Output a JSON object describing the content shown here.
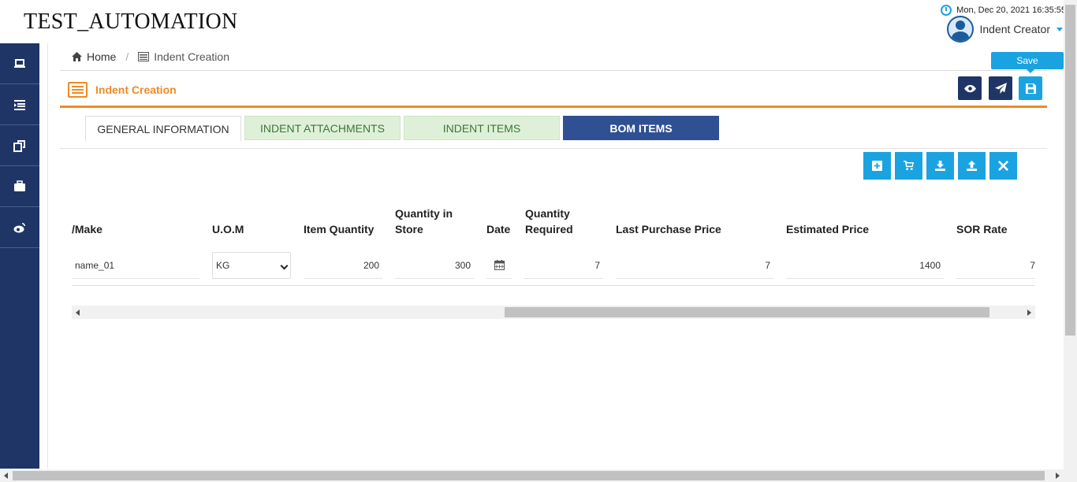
{
  "app": {
    "title": "TEST_AUTOMATION"
  },
  "header": {
    "datetime": "Mon, Dec 20, 2021 16:35:55",
    "user_name": "Indent Creator"
  },
  "sidebar": {
    "items": [
      {
        "icon": "laptop-icon"
      },
      {
        "icon": "indent-list-icon"
      },
      {
        "icon": "copy-icon"
      },
      {
        "icon": "briefcase-icon"
      },
      {
        "icon": "weibo-icon"
      }
    ]
  },
  "breadcrumb": {
    "home": "Home",
    "current": "Indent Creation"
  },
  "page": {
    "title": "Indent Creation"
  },
  "actions": {
    "tooltip": "Save"
  },
  "tabs": [
    {
      "label": "GENERAL INFORMATION"
    },
    {
      "label": "INDENT ATTACHMENTS"
    },
    {
      "label": "INDENT ITEMS"
    },
    {
      "label": "BOM ITEMS"
    }
  ],
  "table": {
    "headers": {
      "make": "/Make",
      "uom": "U.O.M",
      "item_qty": "Item Quantity",
      "qty_store_1": "Quantity in",
      "qty_store_2": "Store",
      "date": "Date",
      "qty_req_1": "Quantity",
      "qty_req_2": "Required",
      "last_price": "Last Purchase Price",
      "est_price": "Estimated Price",
      "sor": "SOR Rate"
    },
    "row": {
      "make": "name_01",
      "uom": "KG",
      "item_qty": "200",
      "qty_store": "300",
      "qty_req": "7",
      "last_price": "7",
      "est_price": "1400",
      "sor": "7"
    }
  },
  "colors": {
    "sidebar": "#1f3566",
    "accent_orange": "#ef8a26",
    "accent_cyan": "#1aa3e0",
    "tab_active": "#2f5092",
    "tab_green": "#dff0d8"
  }
}
